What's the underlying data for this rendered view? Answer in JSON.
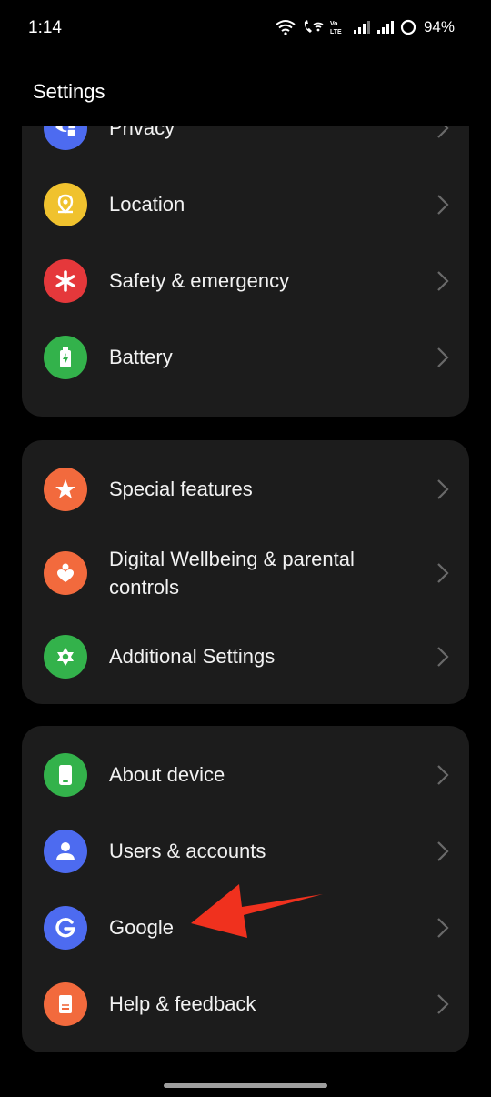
{
  "status_bar": {
    "time": "1:14",
    "battery": "94%",
    "volte_label": "Vo LTE"
  },
  "header": {
    "title": "Settings"
  },
  "cards": [
    {
      "items": [
        {
          "label": "Privacy",
          "icon": "privacy-icon",
          "color": "#4d6bf0"
        },
        {
          "label": "Location",
          "icon": "location-icon",
          "color": "#f0c22e"
        },
        {
          "label": "Safety & emergency",
          "icon": "asterisk-icon",
          "color": "#e5383b"
        },
        {
          "label": "Battery",
          "icon": "battery-icon",
          "color": "#33b24b"
        }
      ]
    },
    {
      "items": [
        {
          "label": "Special features",
          "icon": "star-icon",
          "color": "#f26a3d"
        },
        {
          "label": "Digital Wellbeing & parental controls",
          "icon": "heart-person-icon",
          "color": "#f26a3d"
        },
        {
          "label": "Additional Settings",
          "icon": "gear-icon",
          "color": "#33b24b"
        }
      ]
    },
    {
      "items": [
        {
          "label": "About device",
          "icon": "phone-icon",
          "color": "#33b24b"
        },
        {
          "label": "Users & accounts",
          "icon": "user-icon",
          "color": "#4d6bf0"
        },
        {
          "label": "Google",
          "icon": "google-icon",
          "color": "#4d6bf0"
        },
        {
          "label": "Help & feedback",
          "icon": "help-icon",
          "color": "#f26a3d"
        }
      ]
    }
  ],
  "annotation": {
    "arrow_color": "#f0311e"
  }
}
